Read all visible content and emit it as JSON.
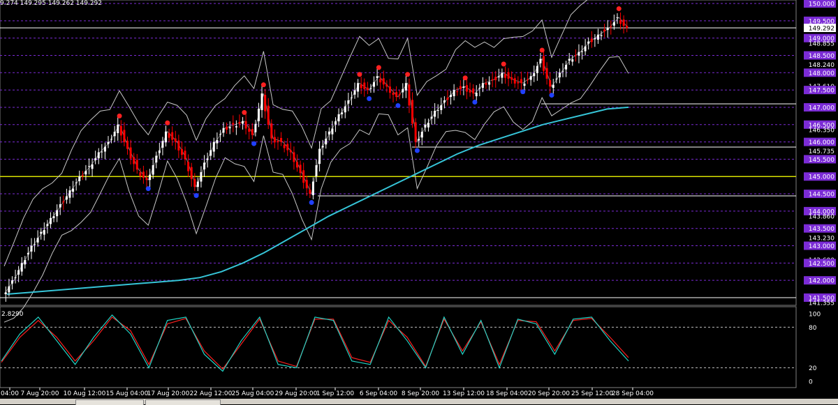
{
  "window": {
    "ohlc_text": "9.274 149.295 149.262 149.292"
  },
  "price_axis": {
    "labels": [
      "150.000",
      "149.500",
      "149.000",
      "148.855",
      "148.500",
      "148.240",
      "148.000",
      "147.610",
      "147.500",
      "147.000",
      "146.500",
      "146.350",
      "146.000",
      "145.735",
      "145.500",
      "145.000",
      "144.500",
      "144.000",
      "143.860",
      "143.500",
      "143.230",
      "143.000",
      "142.600",
      "142.500",
      "142.000",
      "141.500",
      "141.355"
    ],
    "highlighted_labels": [
      "150.000",
      "149.500",
      "149.000",
      "148.500",
      "148.000",
      "147.500",
      "147.000",
      "146.500",
      "146.000",
      "145.500",
      "145.000",
      "144.500",
      "144.000",
      "143.500",
      "143.000",
      "142.500",
      "142.000",
      "141.500"
    ],
    "current_price": "149.292"
  },
  "oscillator": {
    "value_label": "2.8290",
    "levels": [
      "100",
      "80",
      "20",
      "0"
    ]
  },
  "time_axis": {
    "labels": [
      "04:00",
      "7 Aug 20:00",
      "10 Aug 12:00",
      "15 Aug 04:00",
      "17 Aug 20:00",
      "22 Aug 12:00",
      "25 Aug 04:00",
      "29 Aug 20:00",
      "1 Sep 12:00",
      "6 Sep 04:00",
      "8 Sep 20:00",
      "13 Sep 12:00",
      "18 Sep 04:00",
      "20 Sep 20:00",
      "25 Sep 12:00",
      "28 Sep 04:00"
    ]
  },
  "colors": {
    "background": "#000000",
    "bull_candle": "#ffffff",
    "bear_candle": "#ff0000",
    "ma_line": "#36c5d8",
    "grid_level": "#7b2bd6",
    "level_box": "#7b2bd6",
    "yellow_line": "#d8e000",
    "stoch_main": "#22d3c5",
    "stoch_signal": "#ff2020",
    "peak_marker": "#ff2020",
    "trough_marker": "#2040ff"
  },
  "chart_data": {
    "type": "candlestick",
    "ylim": [
      141.355,
      150.0
    ],
    "horizontal_levels": [
      150.0,
      149.5,
      149.0,
      148.5,
      148.0,
      147.5,
      147.0,
      146.5,
      146.0,
      145.5,
      145.0,
      144.5,
      144.0,
      143.5,
      143.0,
      142.5,
      142.0,
      141.5
    ],
    "support_lines": [
      147.1,
      145.85,
      144.44,
      141.5
    ],
    "highlight_level": 145.0,
    "close_series": [
      141.6,
      142.0,
      142.5,
      143.0,
      143.4,
      143.8,
      144.2,
      144.6,
      145.0,
      145.3,
      145.7,
      146.0,
      146.5,
      145.8,
      145.2,
      144.9,
      145.6,
      146.3,
      146.0,
      145.5,
      144.7,
      145.4,
      146.0,
      146.4,
      146.5,
      146.6,
      146.2,
      147.4,
      146.1,
      146.0,
      145.7,
      145.1,
      144.5,
      145.8,
      146.3,
      146.8,
      147.2,
      147.7,
      147.5,
      147.9,
      147.6,
      147.3,
      147.7,
      146.0,
      146.5,
      146.9,
      147.2,
      147.5,
      147.6,
      147.4,
      147.7,
      147.8,
      148.0,
      147.8,
      147.7,
      147.9,
      148.4,
      147.6,
      148.0,
      148.4,
      148.6,
      148.9,
      149.1,
      149.3,
      149.6,
      149.29
    ],
    "ma_series": [
      141.6,
      141.65,
      141.7,
      141.75,
      141.8,
      141.85,
      141.9,
      141.95,
      142.0,
      142.08,
      142.25,
      142.5,
      142.8,
      143.15,
      143.5,
      143.85,
      144.15,
      144.45,
      144.75,
      145.05,
      145.35,
      145.65,
      145.9,
      146.1,
      146.3,
      146.5,
      146.65,
      146.8,
      146.95,
      147.0
    ],
    "stochastic_main": [
      30,
      70,
      95,
      60,
      25,
      65,
      98,
      70,
      20,
      90,
      95,
      40,
      15,
      60,
      95,
      25,
      20,
      95,
      90,
      30,
      25,
      95,
      60,
      20,
      95,
      40,
      90,
      20,
      92,
      85,
      40,
      92,
      95,
      60,
      30
    ],
    "stochastic_signal": [
      28,
      65,
      90,
      65,
      30,
      60,
      95,
      75,
      25,
      85,
      93,
      45,
      18,
      55,
      92,
      30,
      22,
      92,
      92,
      35,
      28,
      90,
      65,
      22,
      92,
      45,
      88,
      25,
      90,
      88,
      45,
      90,
      93,
      65,
      35
    ]
  }
}
